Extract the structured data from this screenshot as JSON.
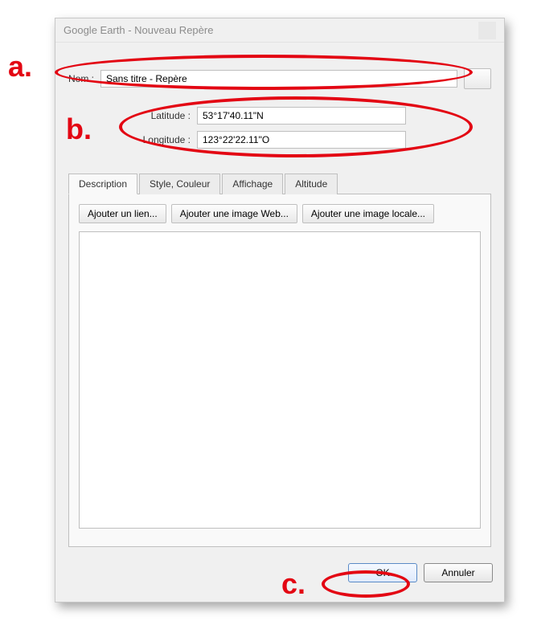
{
  "window": {
    "title": "Google Earth - Nouveau Repère"
  },
  "fields": {
    "name_label": "Nom :",
    "name_value": "Sans titre - Repère",
    "latitude_label": "Latitude :",
    "latitude_value": "53°17'40.11\"N",
    "longitude_label": "Longitude :",
    "longitude_value": "123°22'22.11\"O"
  },
  "tabs": {
    "description": "Description",
    "style": "Style, Couleur",
    "affichage": "Affichage",
    "altitude": "Altitude"
  },
  "desc_buttons": {
    "link": "Ajouter un lien...",
    "web_image": "Ajouter une image Web...",
    "local_image": "Ajouter une image locale..."
  },
  "dialog_buttons": {
    "ok": "OK",
    "cancel": "Annuler"
  },
  "annotations": {
    "a": "a.",
    "b": "b.",
    "c": "c."
  }
}
